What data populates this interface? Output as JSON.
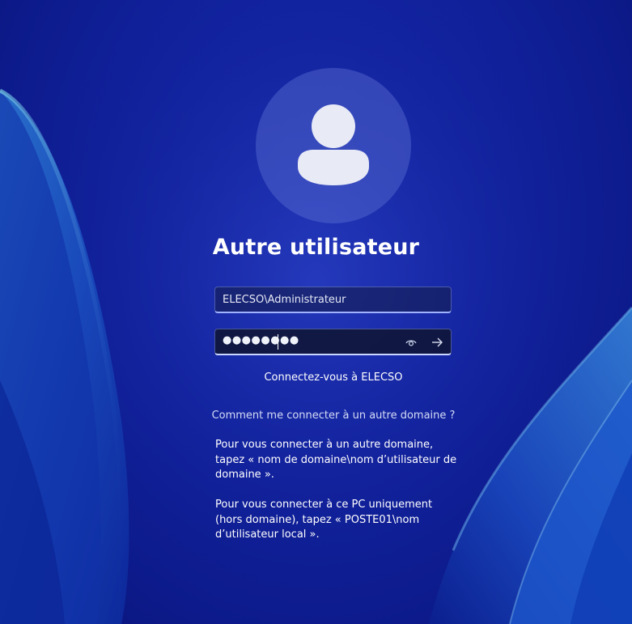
{
  "login": {
    "title": "Autre utilisateur",
    "username_value": "ELECSO\\Administrateur",
    "password_mask": "●●●●●●●●",
    "sign_in_to": "Connectez-vous à ELECSO"
  },
  "help": {
    "link": "Comment me connecter à un autre domaine ?",
    "paragraph_domain": "Pour vous connecter à un autre domaine, tapez « nom de domaine\\nom d’utilisateur de domaine ».",
    "paragraph_local": "Pour vous connecter à ce PC uniquement (hors domaine), tapez « POSTE01\\nom d’utilisateur local »."
  },
  "icons": {
    "avatar": "user-avatar-icon",
    "reveal": "eye-icon",
    "submit": "arrow-right-icon"
  },
  "colors": {
    "background": "#1223a0",
    "text": "#ffffff",
    "field_border": "#9fb3ff"
  }
}
